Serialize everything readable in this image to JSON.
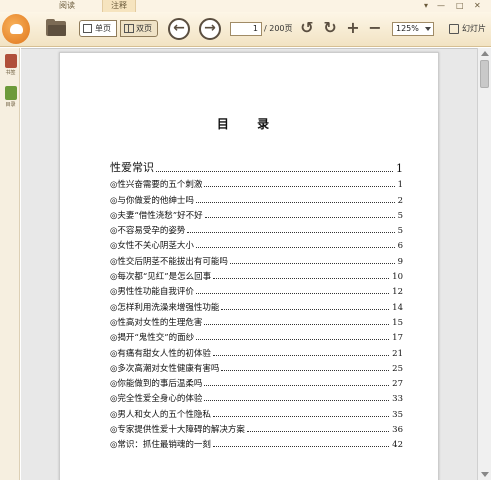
{
  "tabs": [
    {
      "label": "阅读"
    },
    {
      "label": "注释"
    }
  ],
  "window_controls": {
    "menu": "▾",
    "minimize": "—",
    "maximize": "□",
    "close": "✕"
  },
  "toolbar": {
    "single_page_label": "单页",
    "double_page_label": "双页",
    "back_symbol": "←",
    "forward_symbol": "→",
    "current_page": "1",
    "total_pages": "/ 200页",
    "rotate_left_symbol": "↺",
    "rotate_right_symbol": "↻",
    "zoom_in_symbol": "+",
    "zoom_out_symbol": "−",
    "zoom_level": "125%",
    "slideshow_label": "幻灯片"
  },
  "sidebar": {
    "items": [
      {
        "label": "书签",
        "icon": "bookmark-icon",
        "color": "#b0503a"
      },
      {
        "label": "目录",
        "icon": "toc-icon",
        "color": "#6c9a3a"
      }
    ]
  },
  "document": {
    "toc_title": "目 录",
    "entries": [
      {
        "label": "性爱常识",
        "page": "1"
      },
      {
        "label": "◎性兴奋需要的五个刺激",
        "page": "1"
      },
      {
        "label": "◎与你做爱的他绅士吗",
        "page": "2"
      },
      {
        "label": "◎夫妻“借性浇愁”好不好",
        "page": "5"
      },
      {
        "label": "◎不容易受孕的姿势",
        "page": "5"
      },
      {
        "label": "◎女性不关心阴茎大小",
        "page": "6"
      },
      {
        "label": "◎性交后阴茎不能拔出有可能吗",
        "page": "9"
      },
      {
        "label": "◎每次都“见红”是怎么回事",
        "page": "10"
      },
      {
        "label": "◎男性性功能自我评价",
        "page": "12"
      },
      {
        "label": "◎怎样利用洗澡来增强性功能",
        "page": "14"
      },
      {
        "label": "◎性高对女性的生理危害",
        "page": "15"
      },
      {
        "label": "◎揭开“鬼性交”的面纱",
        "page": "17"
      },
      {
        "label": "◎有痛有甜女人性的初体验",
        "page": "21"
      },
      {
        "label": "◎多次高潮对女性健康有害吗",
        "page": "25"
      },
      {
        "label": "◎你能做到的事后温柔吗",
        "page": "27"
      },
      {
        "label": "◎完全性爱全身心的体验",
        "page": "33"
      },
      {
        "label": "◎男人和女人的五个性隐私",
        "page": "35"
      },
      {
        "label": "◎专家提供性爱十大障碍的解决方案",
        "page": "36"
      },
      {
        "label": "◎常识：抓住最销魂的一刻",
        "page": "42"
      }
    ]
  }
}
